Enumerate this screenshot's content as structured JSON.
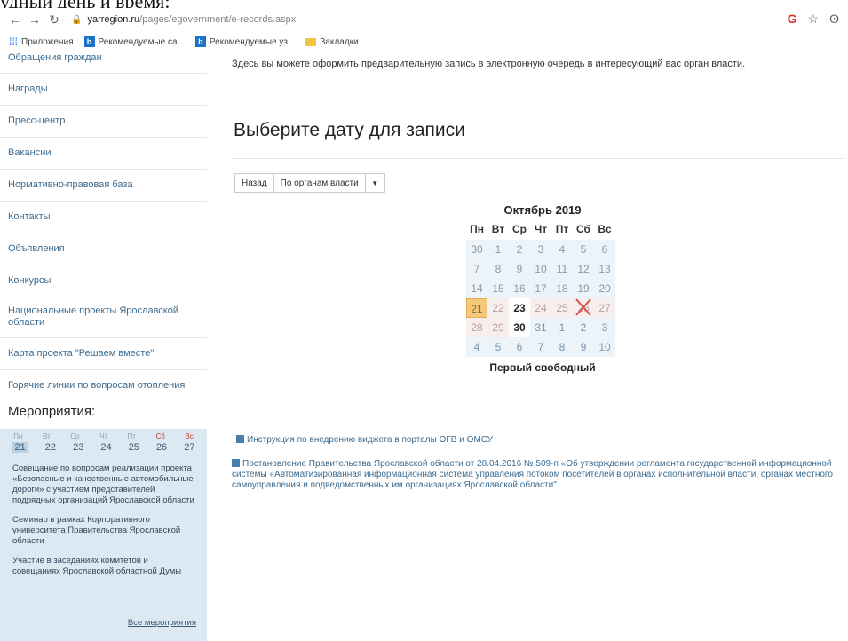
{
  "page_caption_fragment": "удный день и время:",
  "browser": {
    "url_domain": "yarregion.ru",
    "url_path": "/pages/egovernment/e-records.aspx",
    "bookmarks": [
      "Приложения",
      "Рекомендуемые са...",
      "Рекомендуемые уз...",
      "Закладки"
    ]
  },
  "sidebar": {
    "items": [
      "Обращения граждан",
      "Награды",
      "Пресс-центр",
      "Вакансии",
      "Нормативно-правовая база",
      "Контакты",
      "Объявления",
      "Конкурсы",
      "Национальные проекты Ярославской области",
      "Карта проекта \"Решаем вместе\"",
      "Горячие линии по вопросам отопления"
    ],
    "events_title": "Мероприятия:",
    "events_week_days": [
      "Пн",
      "Вт",
      "Ср",
      "Чт",
      "Пт",
      "Сб",
      "Вс"
    ],
    "events_dates": [
      "21",
      "22",
      "23",
      "24",
      "25",
      "26",
      "27"
    ],
    "events": [
      "Совещание по вопросам реализации проекта «Безопасные и качественные автомобильные дороги» с участием представителей подрядных организаций Ярославской области",
      "Семинар в рамках Корпоративного университета Правительства Ярославской области",
      "Участие в заседаниях комитетов и совещаниях Ярославской областной Думы"
    ],
    "events_all_link": "Все мероприятия"
  },
  "main": {
    "intro": "Здесь вы можете оформить предварительную запись в электронную очередь в интересующий вас орган власти.",
    "title": "Выберите дату для записи",
    "back_button": "Назад",
    "filter_button": "По органам власти",
    "calendar": {
      "month": "Октябрь 2019",
      "weekdays": [
        "Пн",
        "Вт",
        "Ср",
        "Чт",
        "Пт",
        "Сб",
        "Вс"
      ],
      "weeks": [
        [
          "30",
          "1",
          "2",
          "3",
          "4",
          "5",
          "6"
        ],
        [
          "7",
          "8",
          "9",
          "10",
          "11",
          "12",
          "13"
        ],
        [
          "14",
          "15",
          "16",
          "17",
          "18",
          "19",
          "20"
        ],
        [
          "21",
          "22",
          "23",
          "24",
          "25",
          "26",
          "27"
        ],
        [
          "28",
          "29",
          "30",
          "31",
          "1",
          "2",
          "3"
        ],
        [
          "4",
          "5",
          "6",
          "7",
          "8",
          "9",
          "10"
        ]
      ],
      "footer": "Первый свободный"
    },
    "doc_link_1": "Инструкция по внедрению виджета в порталы ОГВ и ОМСУ",
    "doc_link_2": "Постановление Правительства Ярославской области от 28.04.2016 № 509-п «Об утверждении регламента государственной информационной системы «Автоматизированная информационная система управления потоком посетителей в органах исполнительной власти, органах местного самоуправления и подведомственных им организациях Ярославской области\""
  }
}
